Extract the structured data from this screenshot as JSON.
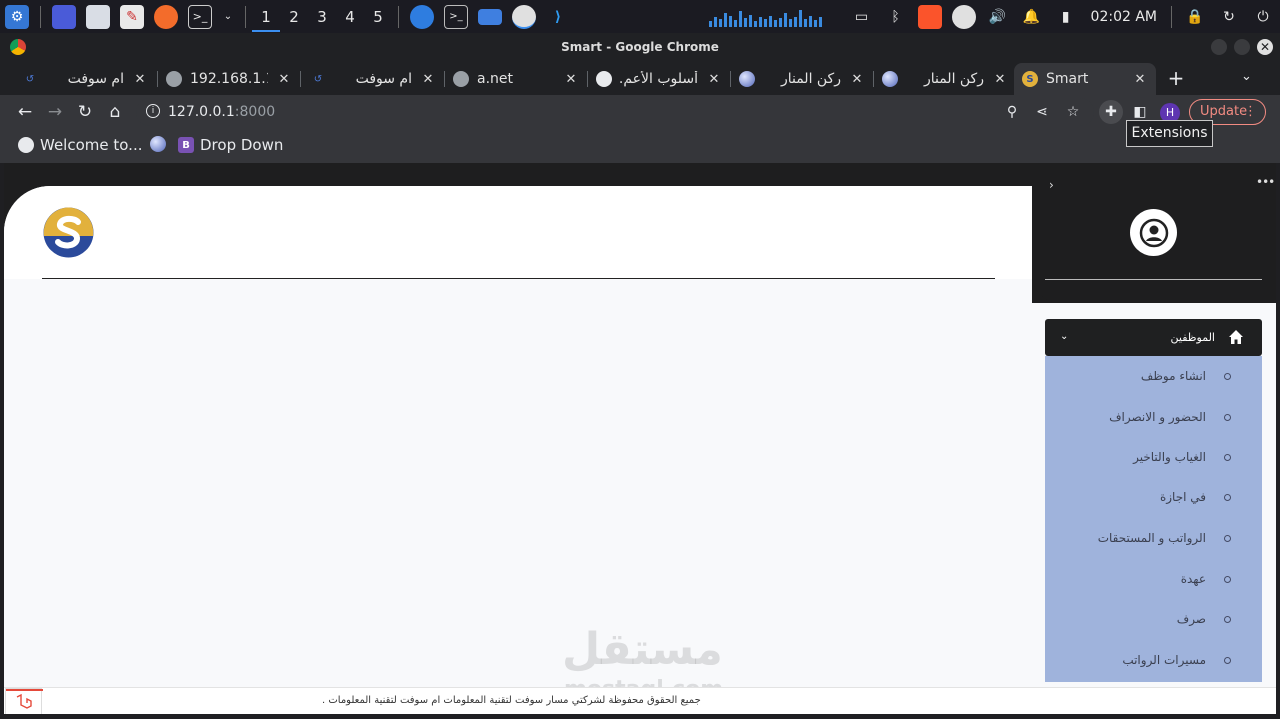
{
  "taskbar": {
    "workspaces": [
      "1",
      "2",
      "3",
      "4",
      "5"
    ],
    "active_workspace": "1",
    "clock": "02:02 AM"
  },
  "window": {
    "title": "Smart - Google Chrome"
  },
  "tabs": [
    {
      "label": "ام سوفت",
      "icon": "arrow-favicon-icon"
    },
    {
      "label": "192.168.1.1",
      "icon": "globe-icon"
    },
    {
      "label": "ام سوفت",
      "icon": "arrow-favicon-icon"
    },
    {
      "label": "a.net",
      "icon": "globe-icon"
    },
    {
      "label": "أسلوب الأعم.",
      "icon": "globe-icon"
    },
    {
      "label": "ركن المنار",
      "icon": "sphere-icon"
    },
    {
      "label": "ركن المنار",
      "icon": "sphere-icon"
    },
    {
      "label": "Smart",
      "icon": "smart-favicon-icon",
      "active": true
    }
  ],
  "toolbar": {
    "url_host": "127.0.0.1",
    "url_port": ":8000",
    "update_label": "Update",
    "profile_initial": "H",
    "tooltip": "Extensions"
  },
  "bookmarks": [
    {
      "label": "Welcome to...",
      "icon": "globe-icon"
    },
    {
      "label": "",
      "icon": "sphere-icon"
    },
    {
      "label": "Drop Down",
      "icon": "bootstrap-icon"
    }
  ],
  "sidebar": {
    "menu_header": "الموظفين",
    "items": [
      "انشاء موظف",
      "الحضور و الانصراف",
      "الغياب والتاخير",
      "في اجازة",
      "الرواتب و المستحقات",
      "عهدة",
      "صرف",
      "مسيرات الرواتب"
    ]
  },
  "footer": {
    "text": "جميع الحقوق محفوظة لشركتي مسار سوفت لتقنية المعلومات ام سوفت لتقنية المعلومات ."
  },
  "watermark": {
    "arabic": "مستقل",
    "latin": "mostaql.com"
  },
  "colors": {
    "submenu_bg": "#9fb3dc",
    "menu_header_bg": "#1f2021",
    "update_accent": "#f28b82",
    "profile_bg": "#5e35b1",
    "logo_gold": "#e2b13c",
    "logo_blue": "#2b4a9b"
  }
}
